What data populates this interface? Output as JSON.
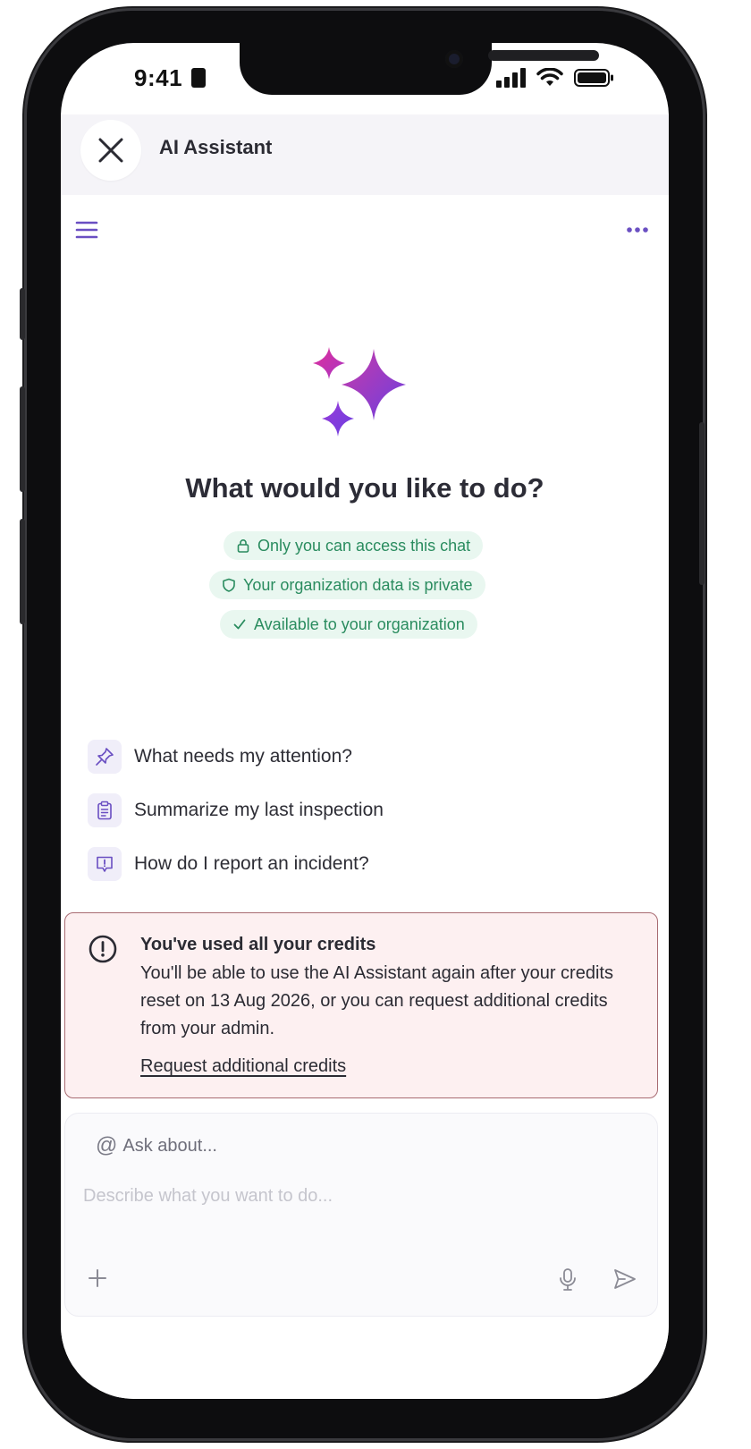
{
  "status_bar": {
    "time": "9:41"
  },
  "header": {
    "title": "AI Assistant"
  },
  "welcome": {
    "heading": "What would you like to do?",
    "badges": [
      {
        "icon": "lock-icon",
        "label": "Only you can access this chat"
      },
      {
        "icon": "shield-icon",
        "label": "Your organization data is private"
      },
      {
        "icon": "check-icon",
        "label": "Available to your organization"
      }
    ]
  },
  "suggestions": [
    {
      "icon": "pin-icon",
      "label": "What needs my attention?"
    },
    {
      "icon": "clipboard-icon",
      "label": "Summarize my last inspection"
    },
    {
      "icon": "report-icon",
      "label": "How do I report an incident?"
    }
  ],
  "credits_alert": {
    "title": "You've used all your credits",
    "body": "You'll be able to use the AI Assistant again after your credits reset on 13 Aug 2026, or you can request additional credits from your admin.",
    "link": "Request additional credits"
  },
  "composer": {
    "ask_about": "Ask about...",
    "placeholder": "Describe what you want to do...",
    "value": ""
  },
  "colors": {
    "accent": "#6a4fc2",
    "badge_bg": "#e9f7f0",
    "badge_text": "#2a8c5f",
    "alert_bg": "#fdf0f1",
    "alert_border": "#a86b72"
  }
}
